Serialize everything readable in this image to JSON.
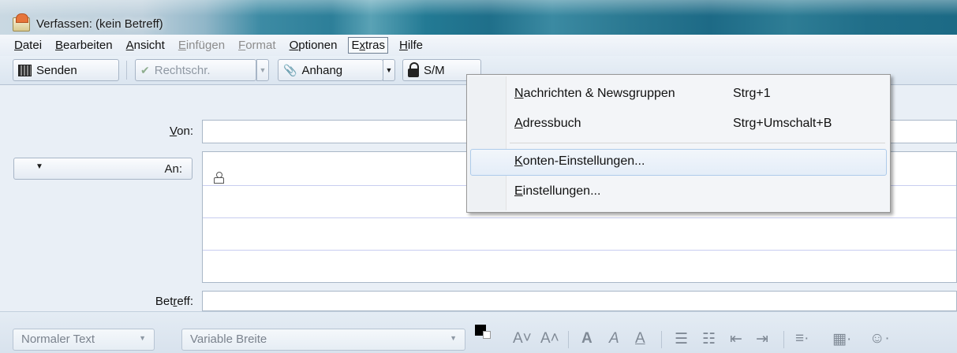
{
  "window": {
    "title": "Verfassen: (kein Betreff)"
  },
  "menubar": {
    "items": [
      {
        "pre": "",
        "key": "D",
        "post": "atei",
        "enabled": true
      },
      {
        "pre": "",
        "key": "B",
        "post": "earbeiten",
        "enabled": true
      },
      {
        "pre": "",
        "key": "A",
        "post": "nsicht",
        "enabled": true
      },
      {
        "pre": "",
        "key": "E",
        "post": "infügen",
        "enabled": false
      },
      {
        "pre": "",
        "key": "F",
        "post": "ormat",
        "enabled": false
      },
      {
        "pre": "",
        "key": "O",
        "post": "ptionen",
        "enabled": true
      },
      {
        "pre": "E",
        "key": "x",
        "post": "tras",
        "enabled": true,
        "open": true
      },
      {
        "pre": "",
        "key": "H",
        "post": "ilfe",
        "enabled": true
      }
    ]
  },
  "toolbar": {
    "send_label": "Senden",
    "spell_label": "Rechtschr.",
    "attach_label": "Anhang",
    "smime_label": "S/M"
  },
  "header": {
    "from_label_pre": "",
    "from_label_key": "V",
    "from_label_post": "on:",
    "to_type": "An:",
    "subject_label_pre": "Bet",
    "subject_label_key": "r",
    "subject_label_post": "eff:",
    "from_value": "",
    "subject_value": ""
  },
  "extras_menu": {
    "items": [
      {
        "key": "N",
        "rest": "achrichten & Newsgruppen",
        "shortcut": "Strg+1"
      },
      {
        "key": "A",
        "rest": "dressbuch",
        "shortcut": "Strg+Umschalt+B"
      },
      {
        "key": "K",
        "rest": "onten-Einstellungen...",
        "shortcut": "",
        "highlighted": true
      },
      {
        "key": "E",
        "rest": "instellungen...",
        "shortcut": ""
      }
    ]
  },
  "formatbar": {
    "paragraph_format": "Normaler Text",
    "font": "Variable Breite",
    "text_color": "#000000",
    "background_color": "#ffffff"
  }
}
